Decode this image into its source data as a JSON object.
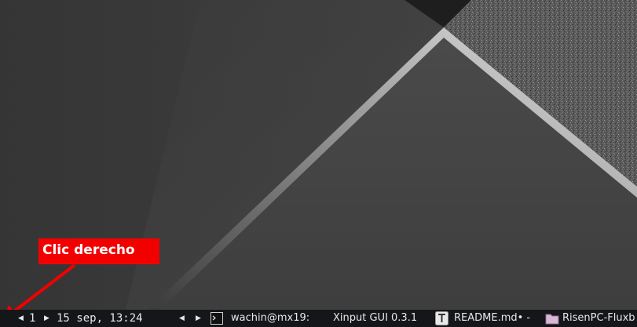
{
  "annotation": {
    "label": "Clic derecho",
    "color": "#f20000"
  },
  "taskbar": {
    "workspace_number": "1",
    "clock": "15 sep, 13:24",
    "tasks": [
      {
        "label": "wachin@mx19:",
        "icon": "terminal-icon"
      },
      {
        "label": "Xinput GUI 0.3.1",
        "icon": ""
      },
      {
        "label": "README.md• -",
        "icon": "text-editor-icon"
      },
      {
        "label": "RisenPC-Fluxb",
        "icon": "folder-icon"
      }
    ]
  },
  "colors": {
    "taskbar_bg": "#141619",
    "wallpaper_base": "#3b3b3b",
    "accent_silver": "#d8d8d8"
  }
}
